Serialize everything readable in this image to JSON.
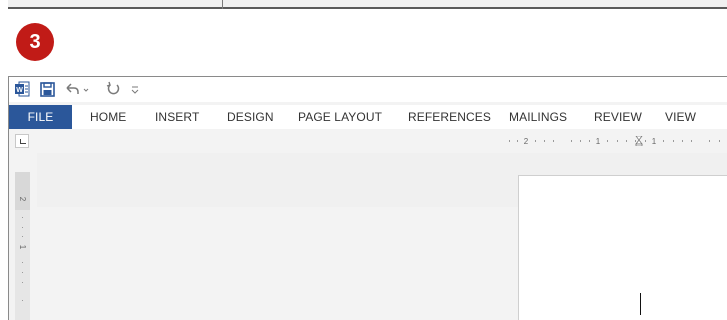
{
  "step": {
    "number": "3"
  },
  "qat": {
    "word_logo_icon": "word-logo-icon",
    "save_icon": "save-icon",
    "undo_icon": "undo-icon",
    "undo_dropdown_icon": "chevron-down-icon",
    "redo_icon": "redo-icon",
    "customize_icon": "customize-qat-icon"
  },
  "ribbon": {
    "tabs": [
      {
        "label": "FILE"
      },
      {
        "label": "HOME"
      },
      {
        "label": "INSERT"
      },
      {
        "label": "DESIGN"
      },
      {
        "label": "PAGE LAYOUT"
      },
      {
        "label": "REFERENCES"
      },
      {
        "label": "MAILINGS"
      },
      {
        "label": "REVIEW"
      },
      {
        "label": "VIEW"
      }
    ]
  },
  "ruler": {
    "horizontal_numbers": [
      "2",
      "1",
      "1"
    ],
    "vertical_numbers": [
      "2",
      "1"
    ]
  },
  "colors": {
    "file_tab": "#2b579a",
    "step_badge": "#c11b17",
    "save_icon": "#2b579a"
  }
}
